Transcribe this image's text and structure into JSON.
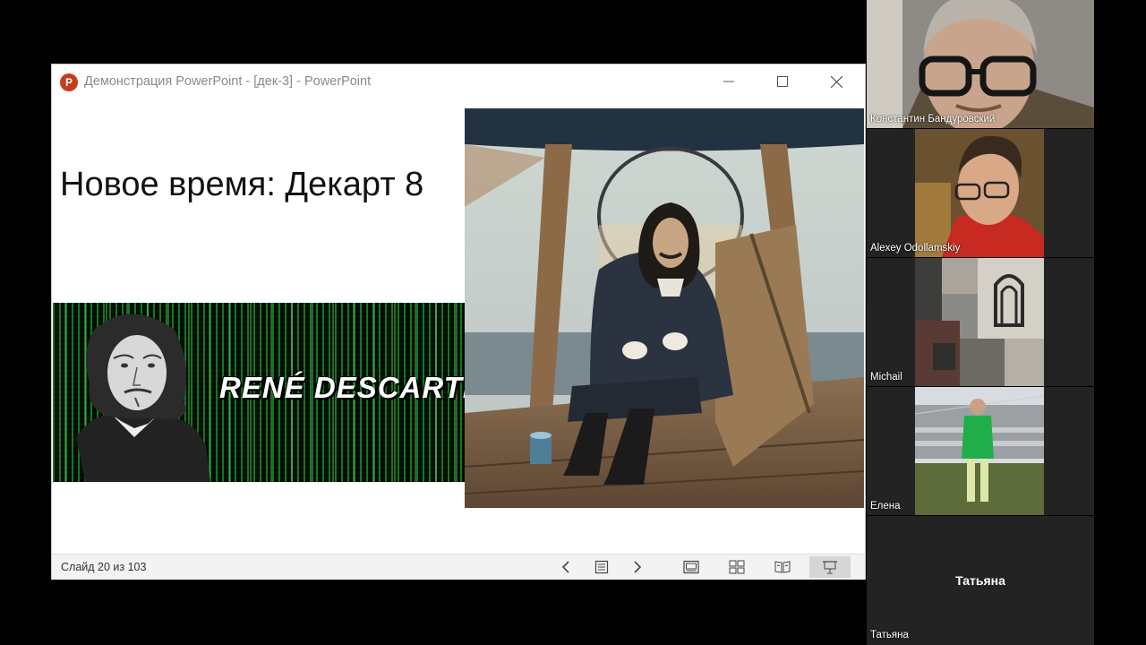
{
  "window": {
    "title": "Демонстрация PowerPoint - [дек-3] - PowerPoint",
    "app_icon_letter": "P",
    "minimize_glyph": "—",
    "maximize_glyph": "☐",
    "close_glyph": "✕"
  },
  "slide": {
    "title": "Новое время: Декарт 8",
    "banner_text": "RENÉ DESCARTES"
  },
  "statusbar": {
    "slide_counter": "Слайд 20 из 103",
    "icons": [
      "previous-slide-icon",
      "slide-menu-icon",
      "next-slide-icon",
      "normal-view-icon",
      "slide-sorter-icon",
      "reading-view-icon",
      "slideshow-icon"
    ]
  },
  "participants": [
    {
      "name": "Константин Бандуровский"
    },
    {
      "name": "Alexey Odollamskiy"
    },
    {
      "name": "Michail"
    },
    {
      "name": "Елена"
    },
    {
      "name": "Татьяна",
      "display_name": "Татьяна"
    }
  ],
  "colors": {
    "powerpoint_brand": "#c43e1c",
    "matrix_green": "#28c83c",
    "jacket_green": "#1fae4a"
  }
}
